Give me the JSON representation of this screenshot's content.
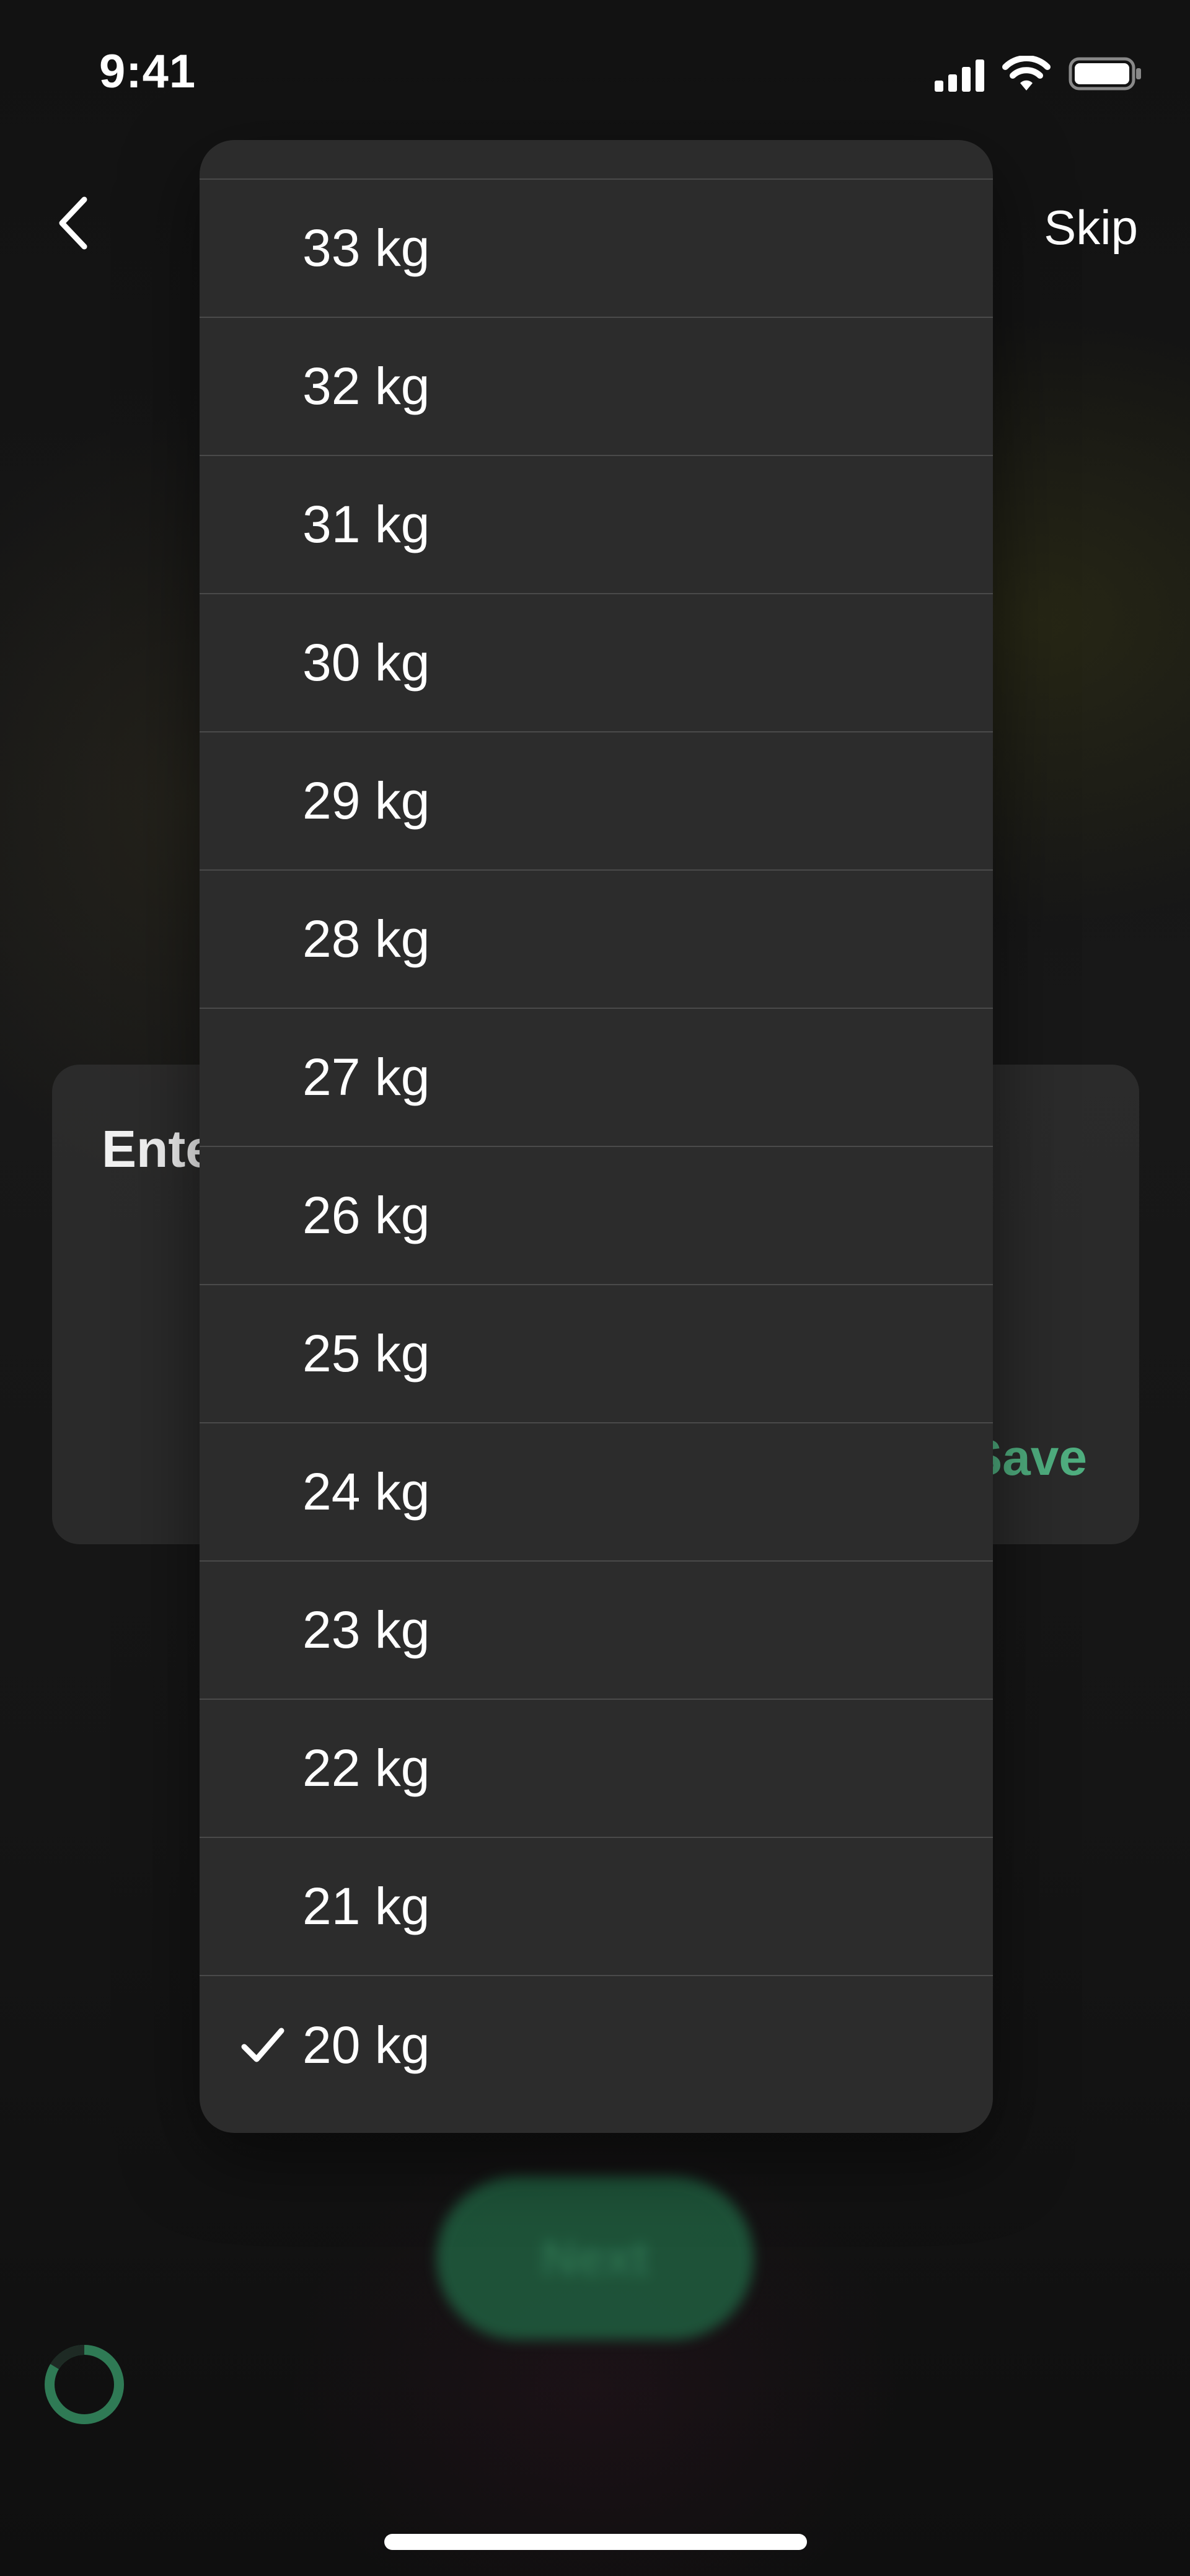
{
  "status_bar": {
    "time": "9:41",
    "icons": [
      "signal-icon",
      "wifi-icon",
      "battery-icon"
    ]
  },
  "nav": {
    "back_icon": "chevron-left-icon",
    "skip_label": "Skip"
  },
  "entry_card": {
    "title": "Ente",
    "save_label": "Save"
  },
  "weight_menu": {
    "items": [
      {
        "label": "33 kg",
        "selected": false
      },
      {
        "label": "32 kg",
        "selected": false
      },
      {
        "label": "31 kg",
        "selected": false
      },
      {
        "label": "30 kg",
        "selected": false
      },
      {
        "label": "29 kg",
        "selected": false
      },
      {
        "label": "28 kg",
        "selected": false
      },
      {
        "label": "27 kg",
        "selected": false
      },
      {
        "label": "26 kg",
        "selected": false
      },
      {
        "label": "25 kg",
        "selected": false
      },
      {
        "label": "24 kg",
        "selected": false
      },
      {
        "label": "23 kg",
        "selected": false
      },
      {
        "label": "22 kg",
        "selected": false
      },
      {
        "label": "21 kg",
        "selected": false
      },
      {
        "label": "20 kg",
        "selected": true
      }
    ]
  },
  "next_button": {
    "label": "Next"
  },
  "colors": {
    "accent_green": "#4fae7f",
    "menu_background": "#2c2c2c",
    "spinner_green": "#2f7a55"
  }
}
